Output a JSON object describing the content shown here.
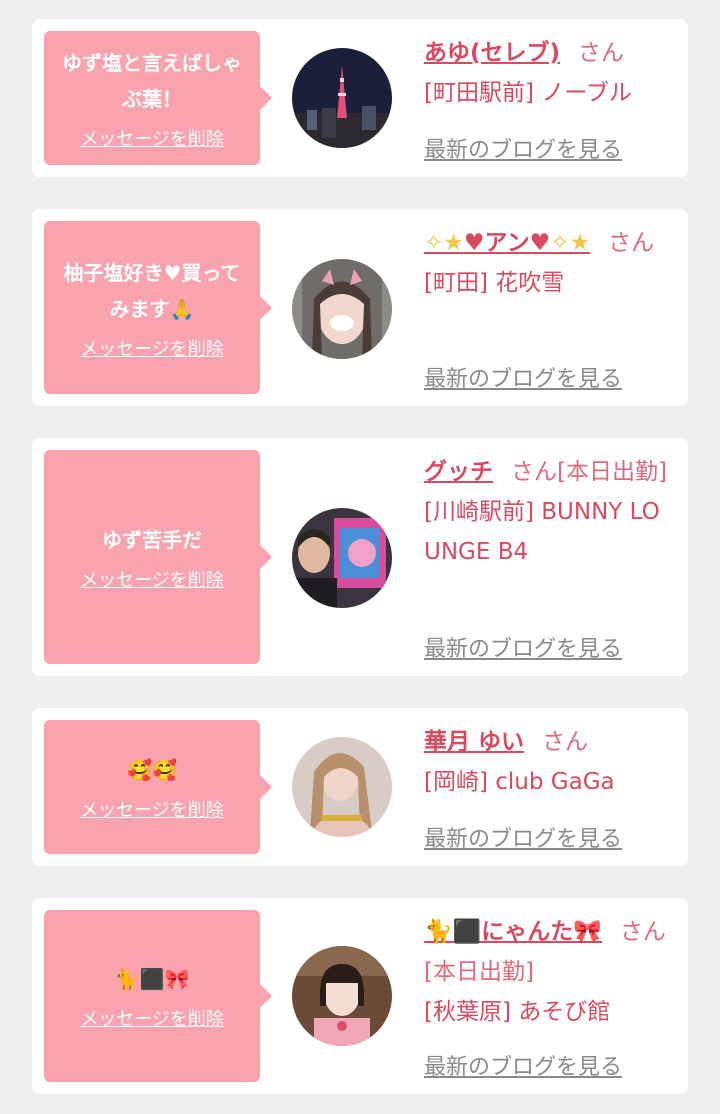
{
  "delete_label": "メッセージを削除",
  "blog_label": "最新のブログを見る",
  "san_label": "さん",
  "items": [
    {
      "message": "ゆず塩と言えばしゃぶ葉！",
      "name": "あゆ(セレブ)",
      "san": "さん",
      "shop": "[町田駅前] ノーブル"
    },
    {
      "message": "柚子塩好き♥買ってみます🙏",
      "name_prefix": "✧★",
      "name": "♥アン♥",
      "name_suffix": "✧★",
      "san": "さん",
      "shop": "[町田] 花吹雪"
    },
    {
      "message": "ゆず苦手だ",
      "name": "グッチ",
      "san": "さん[本日出勤]",
      "shop": "[川崎駅前] BUNNY LOUNGE B4"
    },
    {
      "message": "🥰🥰",
      "name": "華月 ゆい",
      "san": "さん",
      "shop": "[岡崎] club GaGa"
    },
    {
      "message": "🐈⬛🎀",
      "name_prefix": "🐈⬛",
      "name": "にゃんた🎀",
      "san": "さん[本日出勤]",
      "shop": "[秋葉原] あそび館"
    }
  ]
}
